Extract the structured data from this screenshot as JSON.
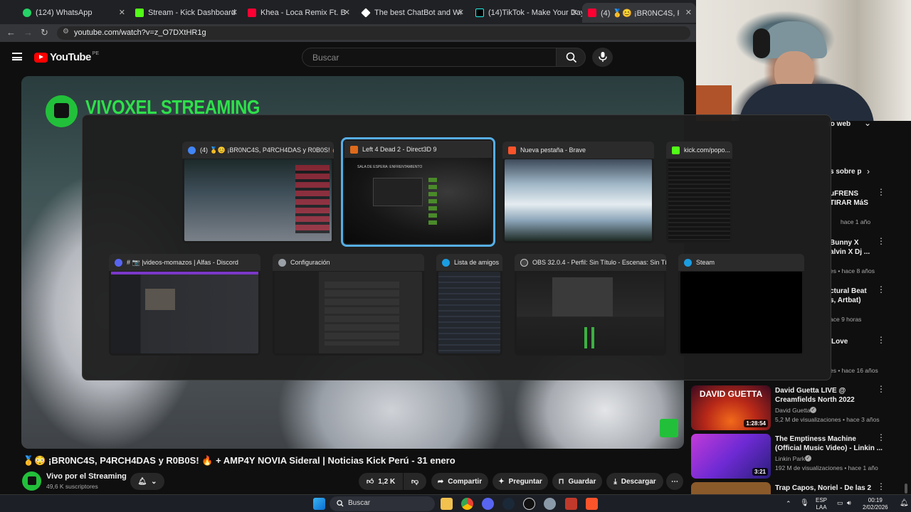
{
  "browser": {
    "tabs": [
      {
        "label": "(124) WhatsApp",
        "color": "#25d366"
      },
      {
        "label": "Stream - Kick Dashboard",
        "color": "#53fc18"
      },
      {
        "label": "Khea - Loca Remix Ft. Bad Bunn",
        "color": "#ff0033"
      },
      {
        "label": "The best ChatBot and Widgets",
        "color": "#ffffff"
      },
      {
        "label": "(14)TikTok - Make Your Day",
        "color": "#000000"
      },
      {
        "label": "(4) 🥇😊 ¡BR0NC4S, P4RCH4D",
        "color": "#ff0033"
      }
    ],
    "url": "youtube.com/watch?v=z_O7DXtHR1g"
  },
  "youtube": {
    "logo_text": "YouTube",
    "country_code": "PE",
    "search_placeholder": "Buscar",
    "video_overlay_title": "VIVOXEL STREAMING",
    "video_title": "🥇😳 ¡BR0NC4S, P4RCH4DAS y R0B0S! 🔥 + AMP4Y NOVIA Sideral | Noticias Kick Perú - 31 enero",
    "channel_name": "Vivo por el Streaming",
    "subscribers": "49,6 K suscriptores",
    "likes": "1,2 K",
    "share_label": "Compartir",
    "ask_label": "Preguntar",
    "save_label": "Guardar",
    "download_label": "Descargar"
  },
  "sidebar": {
    "partial_header": "io web",
    "partial_chip": "s sobre p",
    "items": [
      {
        "title_lines": [
          "uFRENS",
          "TIRAR MáS"
        ],
        "meta": "hace 1 año"
      },
      {
        "title_lines": [
          "Bunny X",
          "alvin X Dj ..."
        ],
        "meta": "es • hace 8 años"
      },
      {
        "title_lines": [
          "ctural Beat",
          "s, Artbat)"
        ],
        "meta": "ace 9 horas"
      },
      {
        "title_lines": [
          "Love"
        ],
        "meta": "es • hace 16 años"
      },
      {
        "title_lines": [
          "David Guetta LIVE @",
          "Creamfields North 2022"
        ],
        "channel": "David Guetta",
        "meta": "5,2 M de visualizaciones • hace 3 años",
        "duration": "1:28:54",
        "thumb_text": "DAVID GUETTA"
      },
      {
        "title_lines": [
          "The Emptiness Machine",
          "(Official Music Video) - Linkin ..."
        ],
        "channel": "Linkin Park",
        "meta": "192 M de visualizaciones • hace 1 año",
        "duration": "3:21"
      },
      {
        "title_lines": [
          "Trap Capos, Noriel - De las 2"
        ]
      }
    ]
  },
  "switcher": {
    "windows_row1": [
      {
        "title": "(4) 🥇😊 ¡BR0NC4S, P4RCH4DAS y R0B0S! 🔥 +...",
        "icon_color": "#4285f4"
      },
      {
        "title": "Left 4 Dead 2 - Direct3D 9",
        "icon_color": "#e06a1b",
        "selected": true
      },
      {
        "title": "Nueva pestaña - Brave",
        "icon_color": "#fb542b"
      },
      {
        "title": "kick.com/popo...",
        "icon_color": "#53fc18"
      }
    ],
    "windows_row2": [
      {
        "title": "# 📷 |videos-momazos | Alfas - Discord",
        "icon_color": "#5865f2"
      },
      {
        "title": "Configuración",
        "icon_color": "#9aa0a6"
      },
      {
        "title": "Lista de amigos",
        "icon_color": "#1b9de2"
      },
      {
        "title": "OBS 32.0.4 - Perfil: Sin Título - Escenas: Sin Título",
        "icon_color": "#444444"
      },
      {
        "title": "Steam",
        "icon_color": "#1b9de2"
      }
    ],
    "l4d2_text": "SALA DE ESPERA: ENFRENTAMIENTO"
  },
  "taskbar": {
    "search_placeholder": "Buscar",
    "lang_top": "ESP",
    "lang_bottom": "LAA",
    "time": "00:19",
    "date": "2/02/2026"
  }
}
